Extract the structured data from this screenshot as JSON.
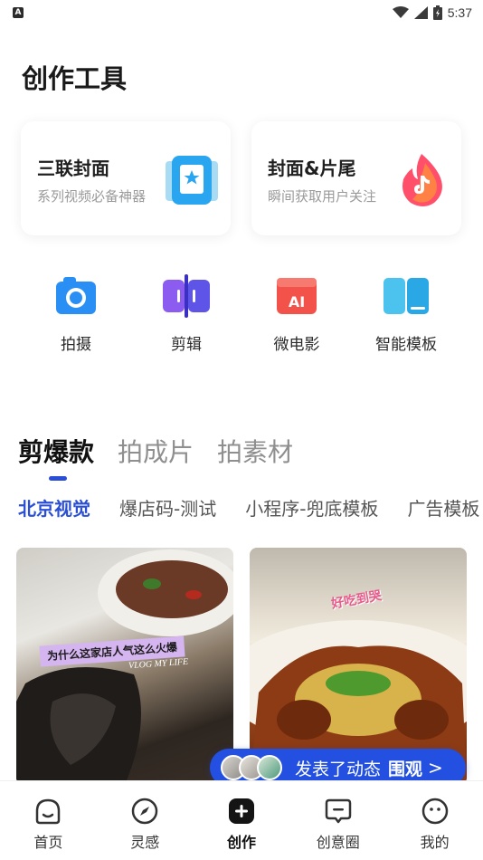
{
  "status_bar": {
    "time": "5:37",
    "left_badge": "A"
  },
  "page_title": "创作工具",
  "cards": [
    {
      "title": "三联封面",
      "subtitle": "系列视频必备神器",
      "icon": "cover-card-icon"
    },
    {
      "title": "封面&片尾",
      "subtitle": "瞬间获取用户关注",
      "icon": "flame-icon"
    }
  ],
  "tools": [
    {
      "label": "拍摄",
      "icon": "camera-icon"
    },
    {
      "label": "剪辑",
      "icon": "clip-icon"
    },
    {
      "label": "微电影",
      "icon": "ai-film-icon"
    },
    {
      "label": "智能模板",
      "icon": "template-icon"
    }
  ],
  "main_tabs": [
    {
      "label": "剪爆款",
      "active": true
    },
    {
      "label": "拍成片",
      "active": false
    },
    {
      "label": "拍素材",
      "active": false
    }
  ],
  "sub_tabs": [
    {
      "label": "北京视觉",
      "active": true
    },
    {
      "label": "爆店码-测试",
      "active": false
    },
    {
      "label": "小程序-兜底模板",
      "active": false
    },
    {
      "label": "广告模板",
      "active": false
    }
  ],
  "thumbnails": {
    "first_caption": "为什么这家店人气这么火爆",
    "first_subcaption": "VLOG MY LIFE",
    "second_caption": "好吃到哭"
  },
  "activity": {
    "text": "发表了动态",
    "action": "围观",
    "arrow": ">"
  },
  "bottom_nav": [
    {
      "label": "首页",
      "icon": "home-face-icon",
      "active": false
    },
    {
      "label": "灵感",
      "icon": "compass-icon",
      "active": false
    },
    {
      "label": "创作",
      "icon": "create-plus-icon",
      "active": true
    },
    {
      "label": "创意圈",
      "icon": "chat-icon",
      "active": false
    },
    {
      "label": "我的",
      "icon": "profile-face-icon",
      "active": false
    }
  ],
  "colors": {
    "accent": "#2a4fd6",
    "pill": "#2350e0"
  }
}
